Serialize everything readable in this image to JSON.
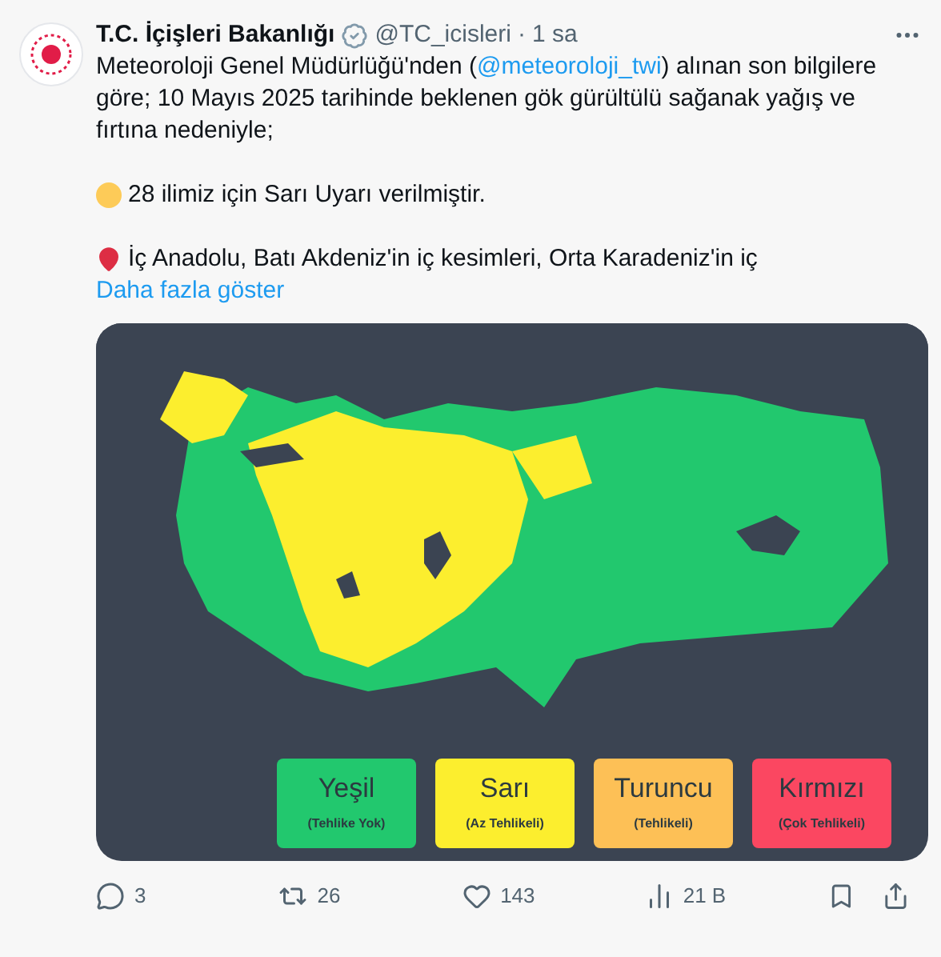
{
  "author": {
    "name": "T.C. İçişleri Bakanlığı",
    "handle": "@TC_icisleri",
    "separator": "·",
    "time": "1 sa"
  },
  "text": {
    "before_mention": "Meteoroloji Genel Müdürlüğü'nden (",
    "mention": "@meteoroloji_twi",
    "after_mention": ") alınan son bilgilere göre; 10 Mayıs 2025 tarihinde beklenen gök gürültülü sağanak yağış ve fırtına nedeniyle;",
    "warning_line": "28 ilimiz için Sarı Uyarı verilmiştir.",
    "region_line": "İç Anadolu, Batı Akdeniz'in iç kesimleri, Orta Karadeniz'in iç",
    "show_more": "Daha fazla göster"
  },
  "media": {
    "kind": "picture",
    "legend": [
      {
        "label": "Yeşil",
        "note": "(Tehlike Yok)",
        "color": "#22c86e"
      },
      {
        "label": "Sarı",
        "note": "(Az Tehlikeli)",
        "color": "#fcee2e"
      },
      {
        "label": "Turuncu",
        "note": "(Tehlikeli)",
        "color": "#fdc056"
      },
      {
        "label": "Kırmızı",
        "note": "(Çok Tehlikeli)",
        "color": "#fb4761"
      }
    ]
  },
  "actions": [
    {
      "kind": "reply",
      "count": "3"
    },
    {
      "kind": "repost",
      "count": "26"
    },
    {
      "kind": "like",
      "count": "143"
    },
    {
      "kind": "views",
      "count": "21 B"
    }
  ]
}
